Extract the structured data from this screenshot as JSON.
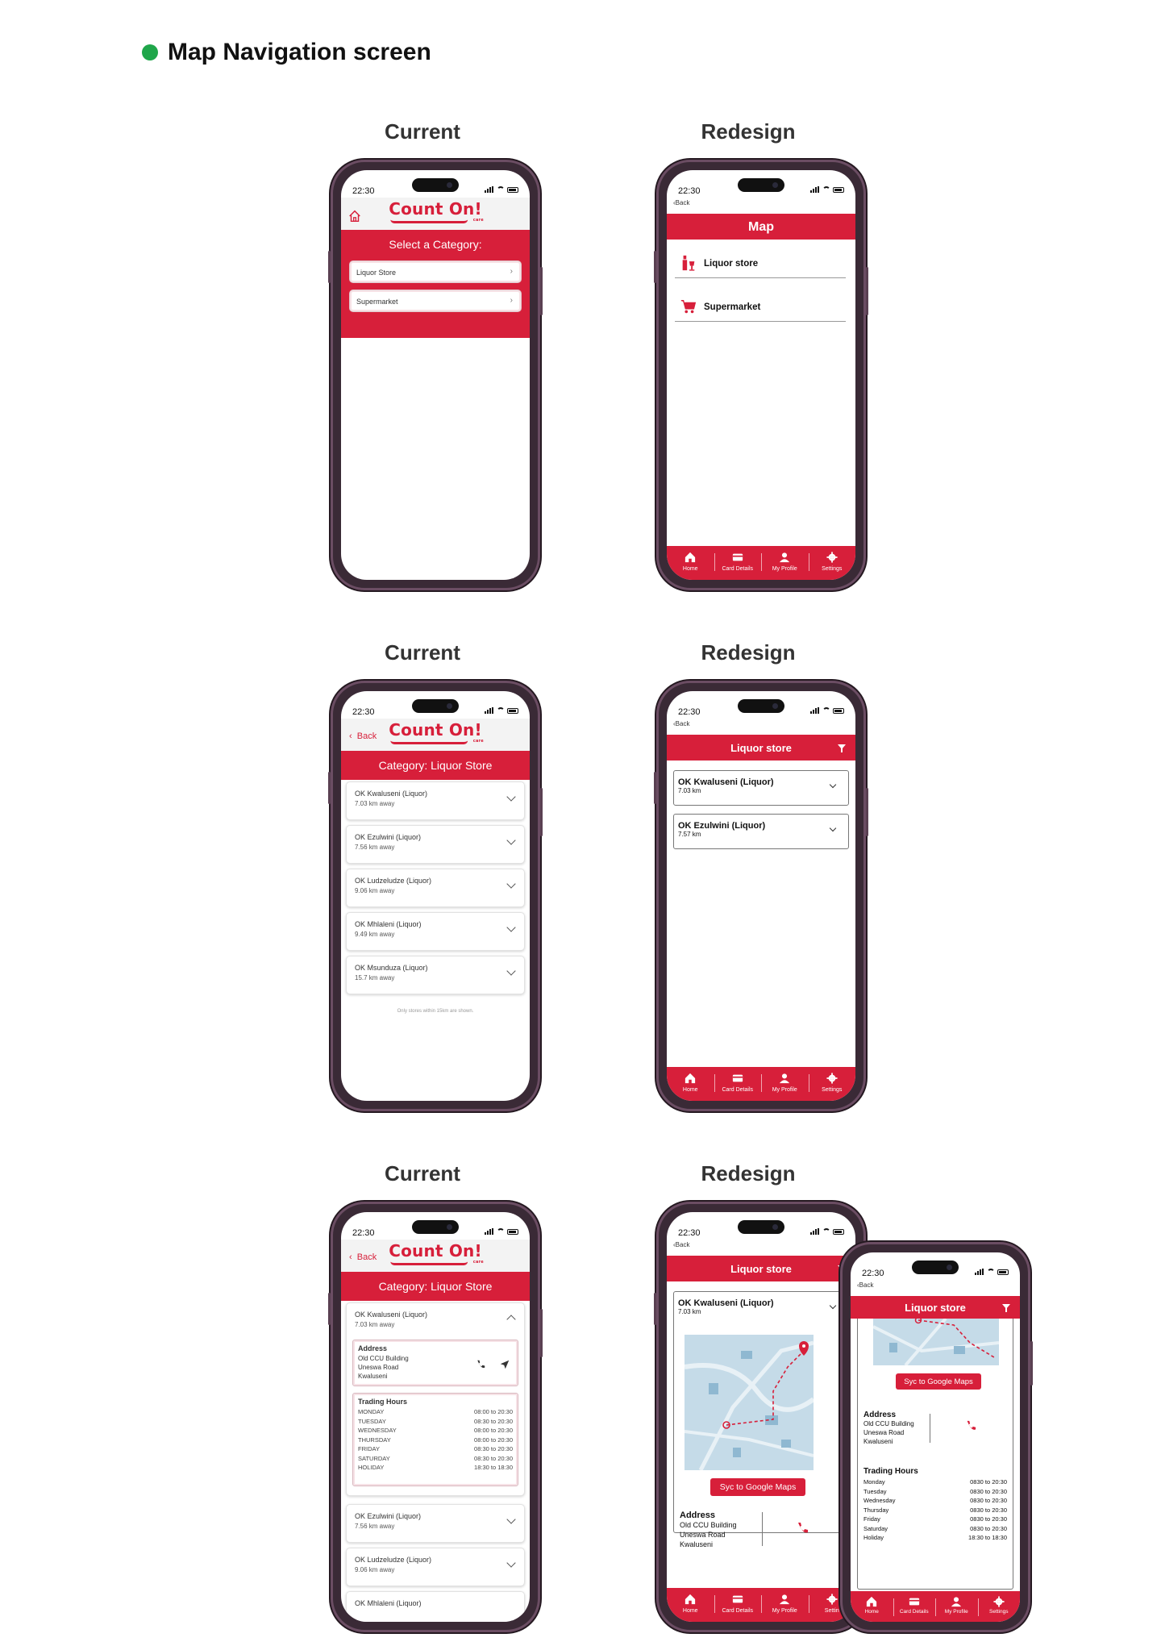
{
  "page": {
    "title": "Map Navigation screen"
  },
  "labels": {
    "current": "Current",
    "redesign": "Redesign"
  },
  "status": {
    "time": "22:30"
  },
  "brand": {
    "logo": "Count On!",
    "logo_sub": "care"
  },
  "old": {
    "back": "Back",
    "select_category": "Select a Category:",
    "categories": [
      "Liquor Store",
      "Supermarket"
    ],
    "category_title": "Category: Liquor Store",
    "stores": [
      {
        "name": "OK Kwaluseni (Liquor)",
        "distance": "7.03 km away"
      },
      {
        "name": "OK Ezulwini (Liquor)",
        "distance": "7.56 km away"
      },
      {
        "name": "OK Ludzeludze (Liquor)",
        "distance": "9.06 km away"
      },
      {
        "name": "OK Mhlaleni (Liquor)",
        "distance": "9.49 km away"
      },
      {
        "name": "OK Msunduza (Liquor)",
        "distance": "15.7 km away"
      }
    ],
    "note": "Only stores within 15km are shown.",
    "address": {
      "label": "Address",
      "lines": [
        "Old CCU Building",
        "Uneswa Road",
        "Kwaluseni"
      ]
    },
    "trading": {
      "label": "Trading Hours",
      "rows": [
        {
          "day": "MONDAY",
          "hours": "08:00 to 20:30"
        },
        {
          "day": "TUESDAY",
          "hours": "08:30 to 20:30"
        },
        {
          "day": "WEDNESDAY",
          "hours": "08:00 to 20:30"
        },
        {
          "day": "THURSDAY",
          "hours": "08:00 to 20:30"
        },
        {
          "day": "FRIDAY",
          "hours": "08:30 to 20:30"
        },
        {
          "day": "SATURDAY",
          "hours": "08:30 to 20:30"
        },
        {
          "day": "HOLIDAY",
          "hours": "18:30 to 18:30"
        }
      ]
    }
  },
  "new": {
    "back": "Back",
    "map_title": "Map",
    "categories": [
      "Liquor store",
      "Supermarket"
    ],
    "list_title": "Liquor store",
    "stores": [
      {
        "name": "OK Kwaluseni (Liquor)",
        "distance": "7.03 km"
      },
      {
        "name": "OK Ezulwini (Liquor)",
        "distance": "7.57 km"
      }
    ],
    "sync": "Syc to Google Maps",
    "address": {
      "label": "Address",
      "lines": [
        "Old CCU Building",
        "Uneswa Road",
        "Kwaluseni"
      ]
    },
    "trading": {
      "label": "Trading Hours",
      "rows": [
        {
          "day": "Monday",
          "hours": "0830 to 20:30"
        },
        {
          "day": "Tuesday",
          "hours": "0830 to 20:30"
        },
        {
          "day": "Wednesday",
          "hours": "0830 to 20:30"
        },
        {
          "day": "Thursday",
          "hours": "0830 to 20:30"
        },
        {
          "day": "Friday",
          "hours": "0830 to 20:30"
        },
        {
          "day": "Saturday",
          "hours": "0830 to 20:30"
        },
        {
          "day": "Holiday",
          "hours": "18:30 to 18:30"
        }
      ]
    },
    "nav": [
      "Home",
      "Card Details",
      "My Profile",
      "Settings"
    ],
    "nav_short": [
      "Home",
      "Card Details",
      "My Profile",
      "Settin"
    ]
  },
  "colors": {
    "brand_red": "#d71f3a",
    "accent_green": "#1fa64a",
    "frame": "#3a2a36"
  }
}
